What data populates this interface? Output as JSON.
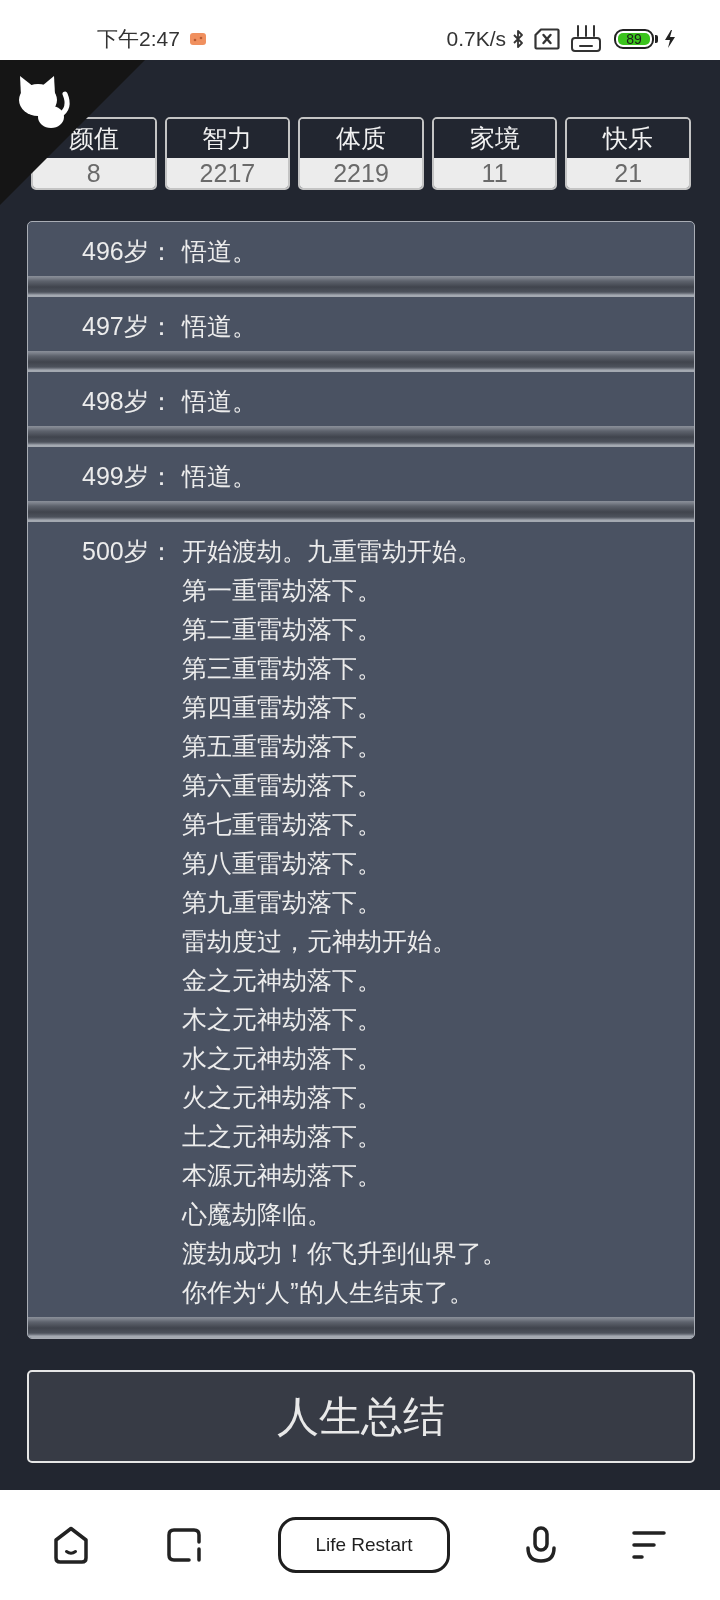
{
  "status_bar": {
    "time": "下午2:47",
    "network_speed": "0.7K/s",
    "battery": "89"
  },
  "stats": [
    {
      "label": "颜值",
      "value": "8"
    },
    {
      "label": "智力",
      "value": "2217"
    },
    {
      "label": "体质",
      "value": "2219"
    },
    {
      "label": "家境",
      "value": "11"
    },
    {
      "label": "快乐",
      "value": "21"
    }
  ],
  "log": [
    {
      "age": "496岁：",
      "lines": [
        "悟道。"
      ]
    },
    {
      "age": "497岁：",
      "lines": [
        "悟道。"
      ]
    },
    {
      "age": "498岁：",
      "lines": [
        "悟道。"
      ]
    },
    {
      "age": "499岁：",
      "lines": [
        "悟道。"
      ]
    },
    {
      "age": "500岁：",
      "lines": [
        "开始渡劫。九重雷劫开始。",
        "第一重雷劫落下。",
        "第二重雷劫落下。",
        "第三重雷劫落下。",
        "第四重雷劫落下。",
        "第五重雷劫落下。",
        "第六重雷劫落下。",
        "第七重雷劫落下。",
        "第八重雷劫落下。",
        "第九重雷劫落下。",
        "雷劫度过，元神劫开始。",
        "金之元神劫落下。",
        "木之元神劫落下。",
        "水之元神劫落下。",
        "火之元神劫落下。",
        "土之元神劫落下。",
        "本源元神劫落下。",
        "心魔劫降临。",
        "渡劫成功！你飞升到仙界了。",
        "你作为“人”的人生结束了。"
      ]
    }
  ],
  "summary_button": {
    "label": "人生总结"
  },
  "nav_bar": {
    "title": "Life Restart"
  }
}
